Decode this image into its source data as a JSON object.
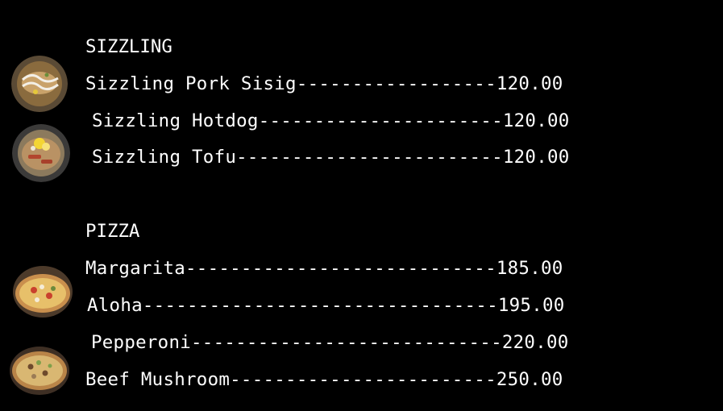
{
  "sections": [
    {
      "heading": "SIZZLING",
      "items": [
        {
          "text": "Sizzling Pork Sisig------------------120.00"
        },
        {
          "text": "Sizzling Hotdog----------------------120.00"
        },
        {
          "text": "Sizzling Tofu------------------------120.00"
        }
      ]
    },
    {
      "heading": "PIZZA",
      "items": [
        {
          "text": "Margarita----------------------------185.00"
        },
        {
          "text": "Aloha--------------------------------195.00"
        },
        {
          "text": "Pepperoni----------------------------220.00"
        },
        {
          "text": "Beef Mushroom------------------------250.00"
        }
      ]
    }
  ],
  "images": [
    {
      "icon": "sisig-plate-icon"
    },
    {
      "icon": "hotdog-bowl-icon"
    },
    {
      "icon": "margarita-pizza-icon"
    },
    {
      "icon": "beef-mushroom-pizza-icon"
    }
  ]
}
